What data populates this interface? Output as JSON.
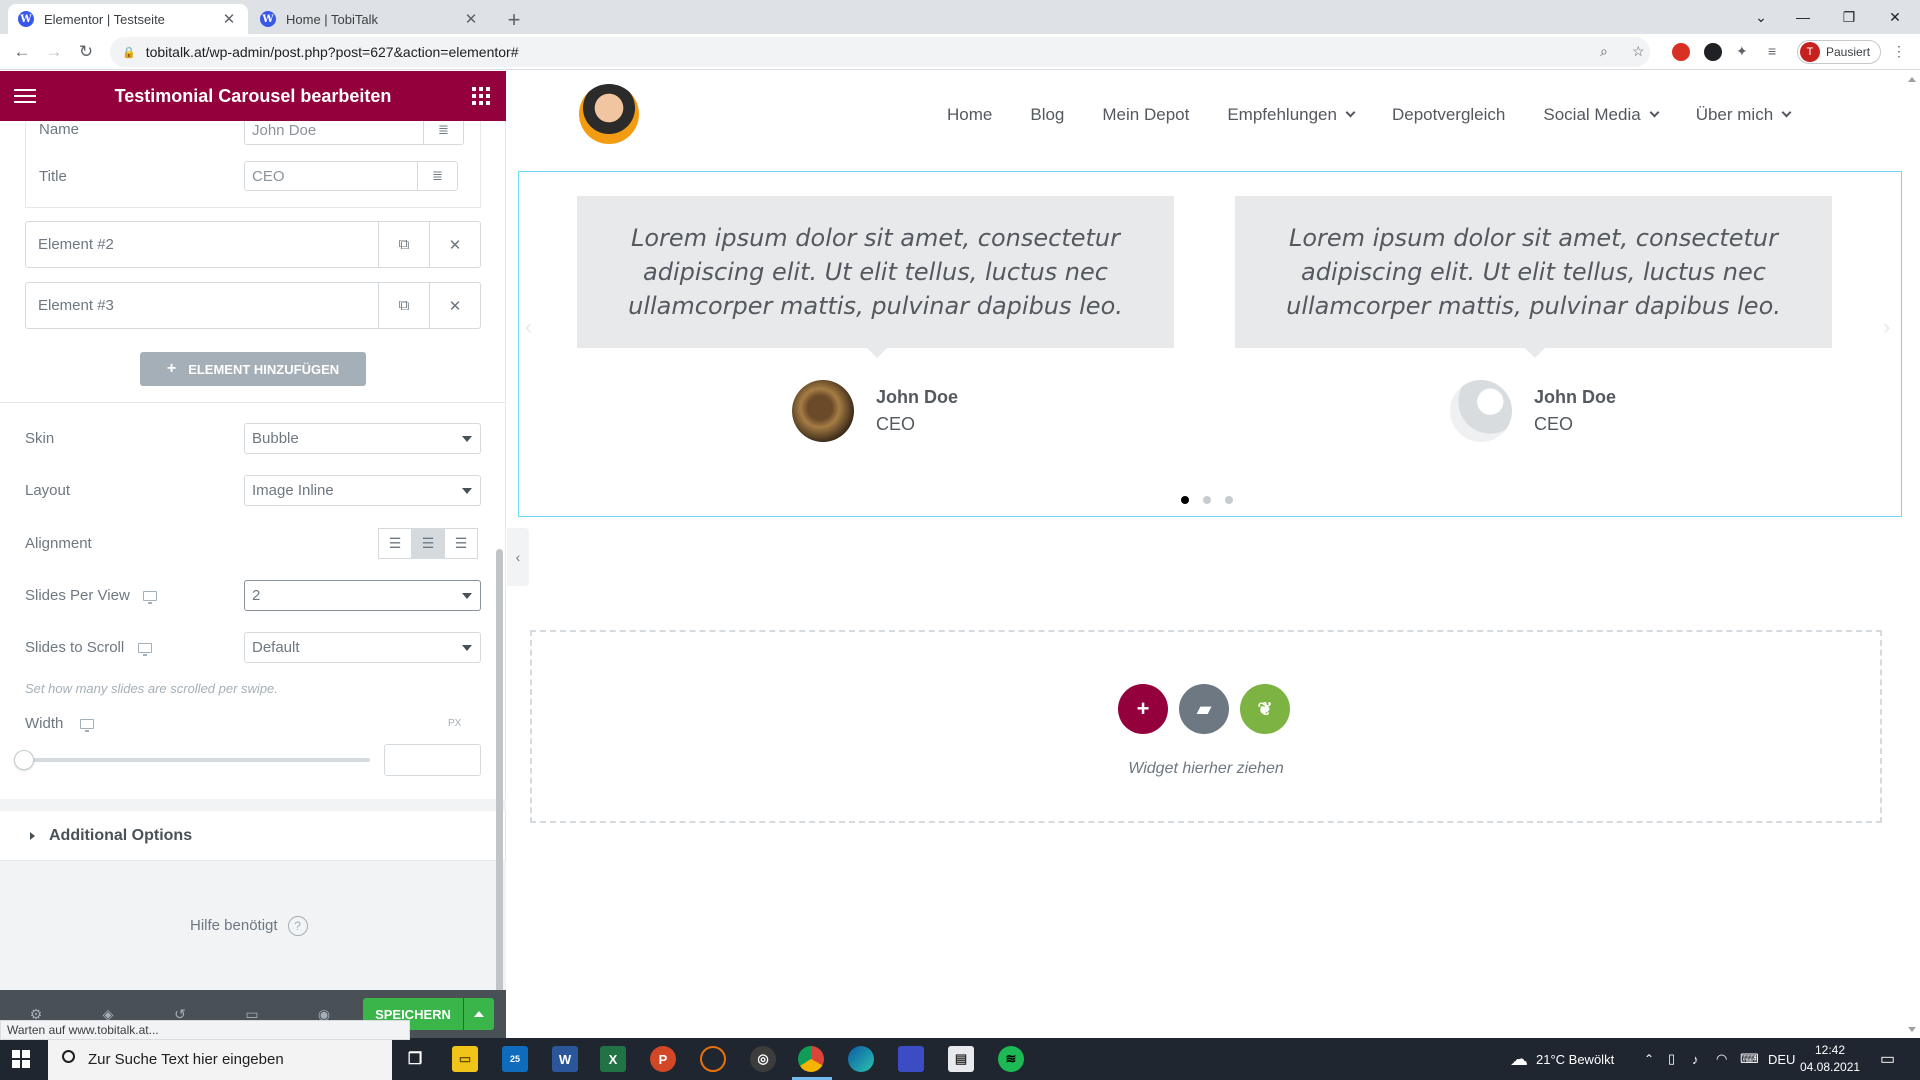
{
  "browser": {
    "tabs": [
      {
        "title": "Elementor | Testseite",
        "favicon": "wordpress-icon",
        "active": true
      },
      {
        "title": "Home | TobiTalk",
        "favicon": "wordpress-icon",
        "active": false
      }
    ],
    "url": "tobitalk.at/wp-admin/post.php?post=627&action=elementor#",
    "profile_label": "Pausiert",
    "profile_initial": "T"
  },
  "panel": {
    "title": "Testimonial Carousel bearbeiten",
    "open_item": {
      "name_label": "Name",
      "name_value": "John Doe",
      "title_label": "Title",
      "title_value": "CEO"
    },
    "items": [
      {
        "label": "Element #2"
      },
      {
        "label": "Element #3"
      }
    ],
    "add_button": "ELEMENT HINZUFÜGEN",
    "skin": {
      "label": "Skin",
      "value": "Bubble"
    },
    "layout": {
      "label": "Layout",
      "value": "Image Inline"
    },
    "alignment": {
      "label": "Alignment",
      "selected": "center"
    },
    "slides_per_view": {
      "label": "Slides Per View",
      "value": "2"
    },
    "slides_to_scroll": {
      "label": "Slides to Scroll",
      "value": "Default",
      "help": "Set how many slides are scrolled per swipe."
    },
    "width": {
      "label": "Width",
      "units": "PX",
      "value": "",
      "slider_percent": 0
    },
    "additional_options": "Additional Options",
    "help": "Hilfe benötigt",
    "save": "SPEICHERN"
  },
  "status_tip": "Warten auf www.tobitalk.at...",
  "site": {
    "nav": [
      {
        "label": "Home",
        "dropdown": false
      },
      {
        "label": "Blog",
        "dropdown": false
      },
      {
        "label": "Mein Depot",
        "dropdown": false
      },
      {
        "label": "Empfehlungen",
        "dropdown": true
      },
      {
        "label": "Depotvergleich",
        "dropdown": false
      },
      {
        "label": "Social Media",
        "dropdown": true
      },
      {
        "label": "Über mich",
        "dropdown": true
      }
    ],
    "testimonials": [
      {
        "text": "Lorem ipsum dolor sit amet, consectetur adipiscing elit. Ut elit tellus, luctus nec ullamcorper mattis, pulvinar dapibus leo.",
        "name": "John Doe",
        "title": "CEO"
      },
      {
        "text": "Lorem ipsum dolor sit amet, consectetur adipiscing elit. Ut elit tellus, luctus nec ullamcorper mattis, pulvinar dapibus leo.",
        "name": "John Doe",
        "title": "CEO"
      }
    ],
    "carousel_dots": 3,
    "carousel_active_dot": 1,
    "dropzone_text": "Widget hierher ziehen"
  },
  "taskbar": {
    "search_placeholder": "Zur Suche Text hier eingeben",
    "weather": "21°C  Bewölkt",
    "lang": "DEU",
    "time": "12:42",
    "date": "04.08.2021",
    "mail_badge": "25"
  },
  "colors": {
    "elementor_header": "#93003c",
    "save_green": "#39b54a",
    "add_circle": "#93003c",
    "folder_circle": "#6d7882",
    "leaf_circle": "#7cb342"
  }
}
